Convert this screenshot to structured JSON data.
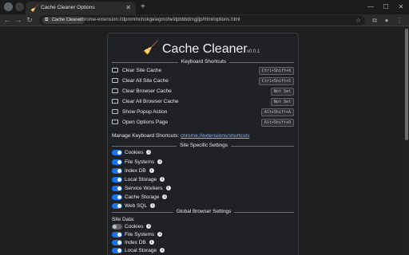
{
  "browser": {
    "tab_title": "Cache Cleaner Options",
    "tab_favicon": "broom-icon",
    "chip_label": "Cache Cleaner",
    "url": "chrome-extension://dpmmlnchokgeiegmoheldpbbbdmgjljp/html/options.html"
  },
  "app": {
    "icon": "🧹",
    "title": "Cache Cleaner",
    "version": "v0.0.1"
  },
  "sections": {
    "keyboard": "Keyboard Shortcuts",
    "site": "Site Specific Settings",
    "global": "Global Browser Settings"
  },
  "shortcuts": [
    {
      "label": "Clear Site Cache",
      "key": "Ctrl+Shift+X"
    },
    {
      "label": "Clear All Site Cache",
      "key": "Ctrl+Shift+S"
    },
    {
      "label": "Clear Browser Cache",
      "key": "Not Set"
    },
    {
      "label": "Clear All Browser Cache",
      "key": "Not Set"
    },
    {
      "label": "Show Popup Action",
      "key": "Alt+Shift+A"
    },
    {
      "label": "Open Options Page",
      "key": "Alt+Shift+O"
    }
  ],
  "manage": {
    "text": "Manage Keyboard Shortcuts:",
    "link": "chrome://extensions/shortcuts"
  },
  "site_settings": [
    {
      "label": "Cookies",
      "on": true
    },
    {
      "label": "File Systems",
      "on": true
    },
    {
      "label": "Index DB",
      "on": true
    },
    {
      "label": "Local Storage",
      "on": true
    },
    {
      "label": "Service Workers",
      "on": true
    },
    {
      "label": "Cache Storage",
      "on": true
    },
    {
      "label": "Web SQL",
      "on": true
    }
  ],
  "global_settings": {
    "site_data_label": "Site Data:",
    "items": [
      {
        "label": "Cookies",
        "on": false
      },
      {
        "label": "File Systems",
        "on": true
      },
      {
        "label": "Index DB",
        "on": true
      },
      {
        "label": "Local Storage",
        "on": true
      }
    ]
  },
  "colors": {
    "accent": "#1a73e8",
    "link": "#8ab4f8",
    "background": "#202124"
  }
}
